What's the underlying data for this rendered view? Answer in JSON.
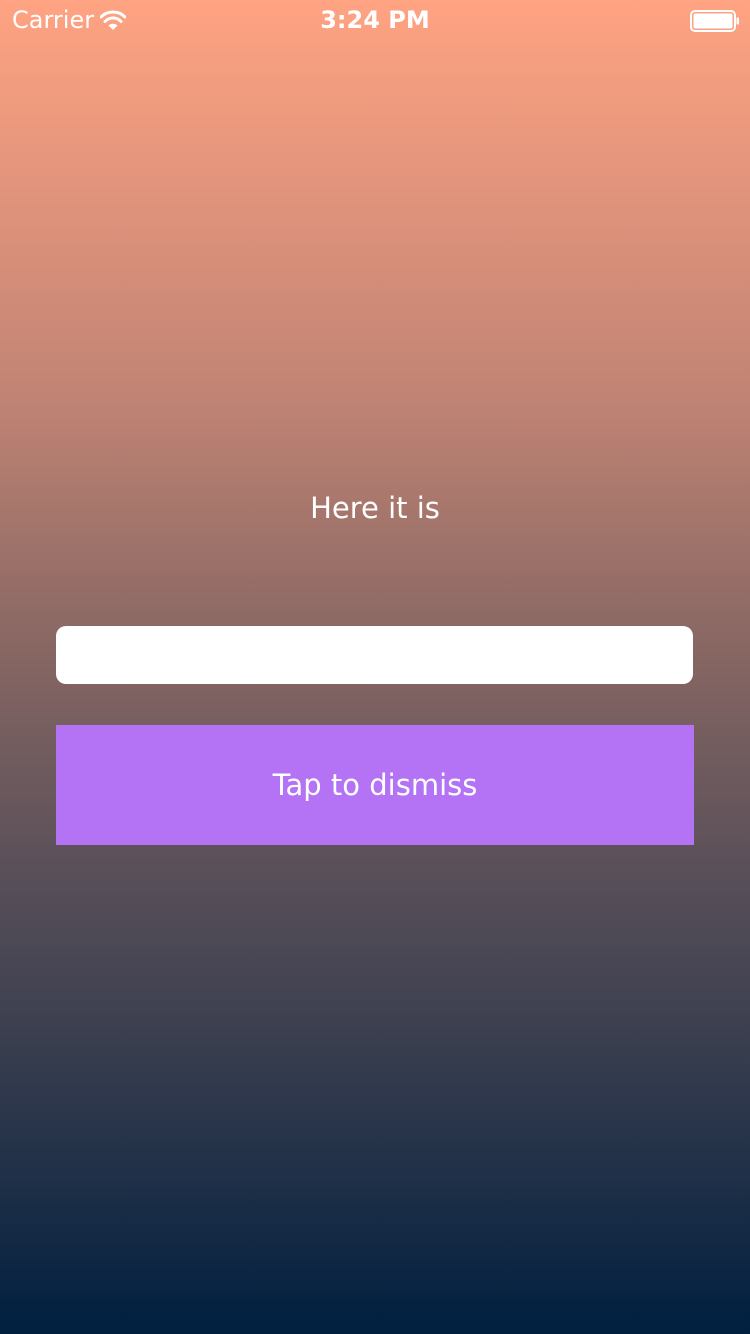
{
  "status_bar": {
    "carrier": "Carrier",
    "time": "3:24 PM",
    "wifi_icon": "wifi-icon",
    "battery_icon": "battery-icon"
  },
  "main": {
    "label": "Here it is",
    "input": {
      "value": "",
      "placeholder": ""
    },
    "dismiss_button_label": "Tap to dismiss"
  },
  "colors": {
    "gradient_top": "#ffa382",
    "gradient_bottom": "#001f3f",
    "button_background": "#b473f5",
    "text": "#ffffff"
  }
}
